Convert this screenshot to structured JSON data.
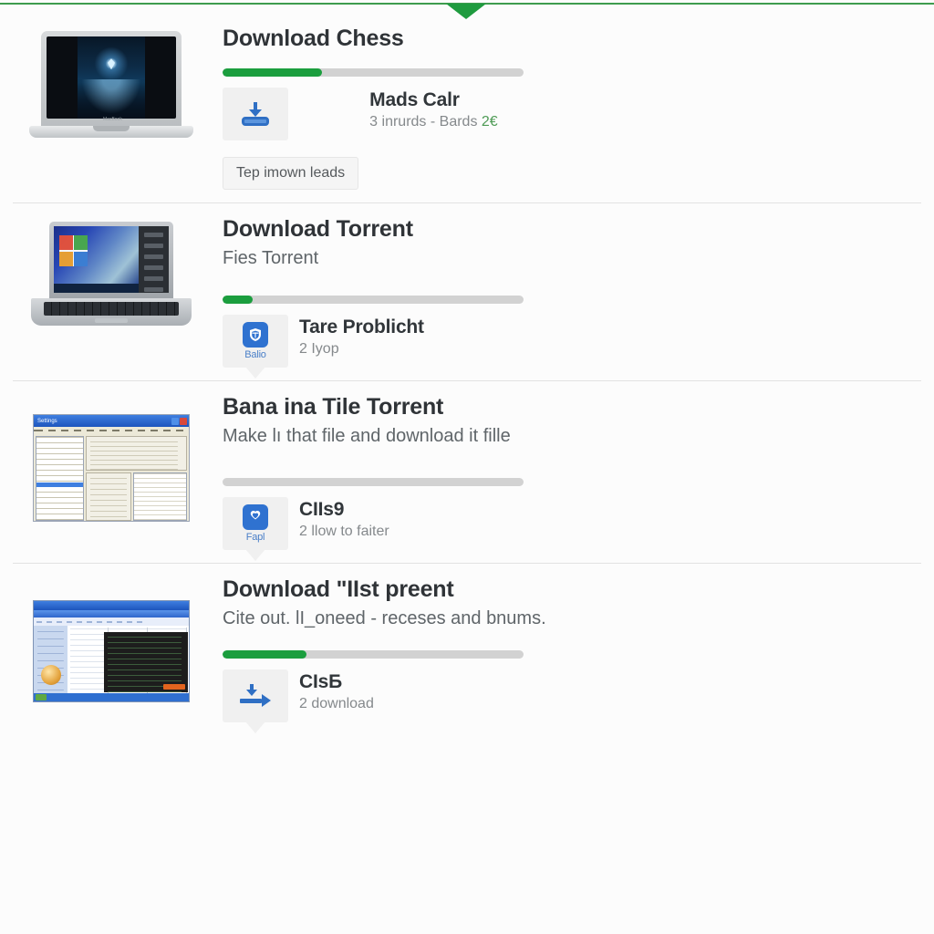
{
  "theme": {
    "accent_green": "#1b9e3e",
    "rule_green": "#3e9c4e",
    "icon_blue": "#2f72d0",
    "page_bg": "#fcfcfc",
    "title_color": "#2f3337",
    "subtitle_color": "#5f6569"
  },
  "header": {
    "caret_icon": "chevron-down-icon"
  },
  "items": [
    {
      "title": "Download Chess",
      "subtitle": "",
      "thumbnail": "macbook-nature-wallpaper-thumbnail",
      "progress_percent": 33,
      "badge": {
        "icon": "download-tray-icon",
        "sublabel": "",
        "has_tail": false
      },
      "meta_title": "Mads Calr",
      "meta_sub": "3 inrurds - Bards",
      "meta_sub_suffix": "2€",
      "tooltip": "Tep imown leads"
    },
    {
      "title": "Download Torrent",
      "subtitle": "Fies Torrent",
      "thumbnail": "windows-laptop-desktop-thumbnail",
      "progress_percent": 10,
      "badge": {
        "icon": "blue-app-tile-icon",
        "sublabel": "Balio",
        "has_tail": true
      },
      "meta_title": "Tare Problicht",
      "meta_sub": "2 Iyop",
      "meta_sub_suffix": "",
      "tooltip": ""
    },
    {
      "title": "Bana ina Tile Torrent",
      "subtitle": "Make lı that file and download it fille",
      "thumbnail": "windows-xp-dialog-thumbnail",
      "progress_percent": 0,
      "badge": {
        "icon": "blue-shield-tile-icon",
        "sublabel": "Fapl",
        "has_tail": true
      },
      "meta_title": "CIIs9",
      "meta_sub": "2 llow to faiter",
      "meta_sub_suffix": "",
      "tooltip": ""
    },
    {
      "title": "Download ʺIIst preent",
      "subtitle": "Cite out. lI_oneed - receses and bnums.",
      "thumbnail": "windows-explorer-console-thumbnail",
      "progress_percent": 28,
      "badge": {
        "icon": "download-forward-arrow-icon",
        "sublabel": "",
        "has_tail": true
      },
      "meta_title": "CIsБ",
      "meta_sub": "2 download",
      "meta_sub_suffix": "",
      "tooltip": ""
    }
  ]
}
